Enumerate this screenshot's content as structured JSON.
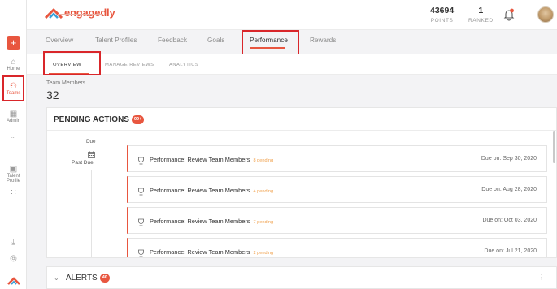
{
  "header": {
    "logo_text": "engagedly",
    "points_value": "43694",
    "points_label": "POINTS",
    "ranked_value": "1",
    "ranked_label": "RANKED"
  },
  "sidebar": {
    "items": [
      {
        "label": "Home",
        "icon": "home-icon"
      },
      {
        "label": "Teams",
        "icon": "teams-icon",
        "active": true
      },
      {
        "label": "Admin",
        "icon": "admin-icon"
      },
      {
        "label": "...",
        "icon": "more-icon"
      },
      {
        "label": "Talent Profile",
        "icon": "talent-profile-icon"
      },
      {
        "label": "",
        "icon": "apps-grid-icon"
      },
      {
        "label": "",
        "icon": "download-icon"
      },
      {
        "label": "",
        "icon": "help-icon"
      }
    ]
  },
  "tabs": [
    "Overview",
    "Talent Profiles",
    "Feedback",
    "Goals",
    "Performance",
    "Rewards"
  ],
  "active_tab": "Performance",
  "subtabs": [
    "OVERVIEW",
    "MANAGE REVIEWS",
    "ANALYTICS"
  ],
  "team": {
    "label": "Team Members",
    "count": "32"
  },
  "pending": {
    "title": "PENDING ACTIONS",
    "badge": "99+",
    "due_label": "Due",
    "past_due_label": "Past Due",
    "rows": [
      {
        "title": "Performance: Review Team Members",
        "pending": "8 pending",
        "due": "Due on: Sep 30, 2020"
      },
      {
        "title": "Performance: Review Team Members",
        "pending": "4 pending",
        "due": "Due on: Aug 28, 2020"
      },
      {
        "title": "Performance: Review Team Members",
        "pending": "7 pending",
        "due": "Due on: Oct 03, 2020"
      },
      {
        "title": "Performance: Review Team Members",
        "pending": "2 pending",
        "due": "Due on: Jul 21, 2020"
      }
    ]
  },
  "alerts": {
    "title": "ALERTS",
    "badge": "40"
  },
  "colors": {
    "accent": "#e8563f",
    "pending_text": "#f0a04b",
    "annotation_red": "#d9262a"
  }
}
